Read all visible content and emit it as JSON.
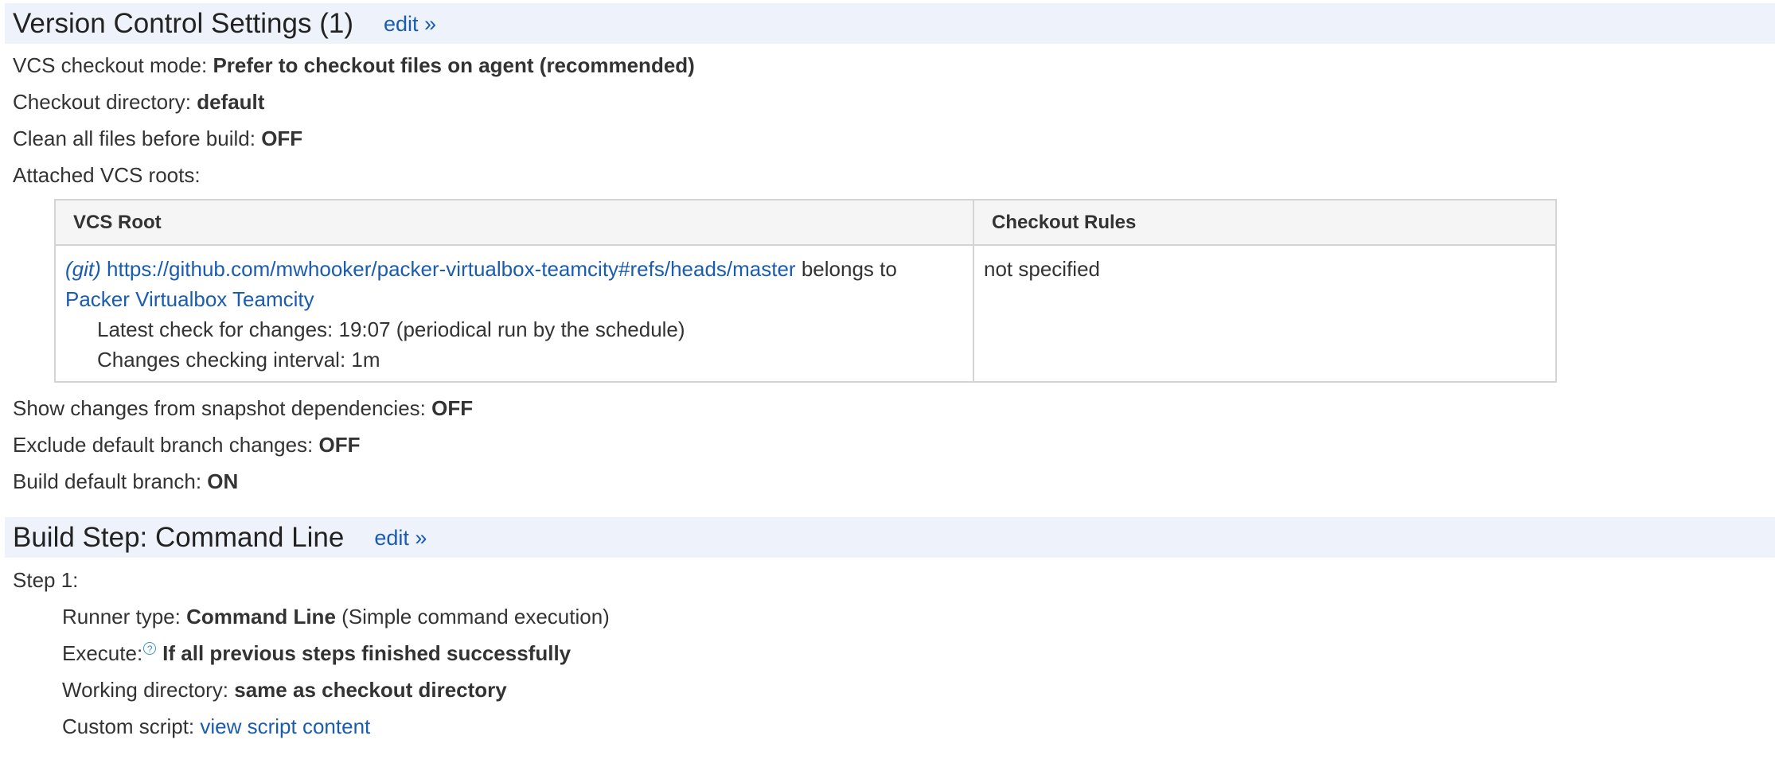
{
  "vcs_section": {
    "title": "Version Control Settings (1)",
    "edit_label": "edit »",
    "checkout_mode_label": "VCS checkout mode:",
    "checkout_mode_value": "Prefer to checkout files on agent (recommended)",
    "checkout_dir_label": "Checkout directory:",
    "checkout_dir_value": "default",
    "clean_label": "Clean all files before build:",
    "clean_value": "OFF",
    "attached_label": "Attached VCS roots:",
    "table": {
      "headers": [
        "VCS Root",
        "Checkout Rules"
      ],
      "row": {
        "vcs_type": "(git)",
        "url": "https://github.com/mwhooker/packer-virtualbox-teamcity#refs/heads/master",
        "belongs_to_text": "belongs to",
        "project": "Packer Virtualbox Teamcity",
        "latest_check": "Latest check for changes: 19:07 (periodical run by the schedule)",
        "interval": "Changes checking interval: 1m",
        "checkout_rules": "not specified"
      }
    },
    "snapshot_label": "Show changes from snapshot dependencies:",
    "snapshot_value": "OFF",
    "exclude_label": "Exclude default branch changes:",
    "exclude_value": "OFF",
    "build_default_label": "Build default branch:",
    "build_default_value": "ON"
  },
  "build_section": {
    "title": "Build Step: Command Line",
    "edit_label": "edit »",
    "step_label": "Step 1:",
    "runner_label": "Runner type:",
    "runner_value": "Command Line",
    "runner_desc": "(Simple command execution)",
    "execute_label": "Execute:",
    "execute_value": "If all previous steps finished successfully",
    "workdir_label": "Working directory:",
    "workdir_value": "same as checkout directory",
    "script_label": "Custom script:",
    "script_link": "view script content"
  },
  "icons": {
    "help": "help-icon"
  },
  "colors": {
    "link": "#1a5cb0",
    "header_bg": "#eef3fb"
  }
}
